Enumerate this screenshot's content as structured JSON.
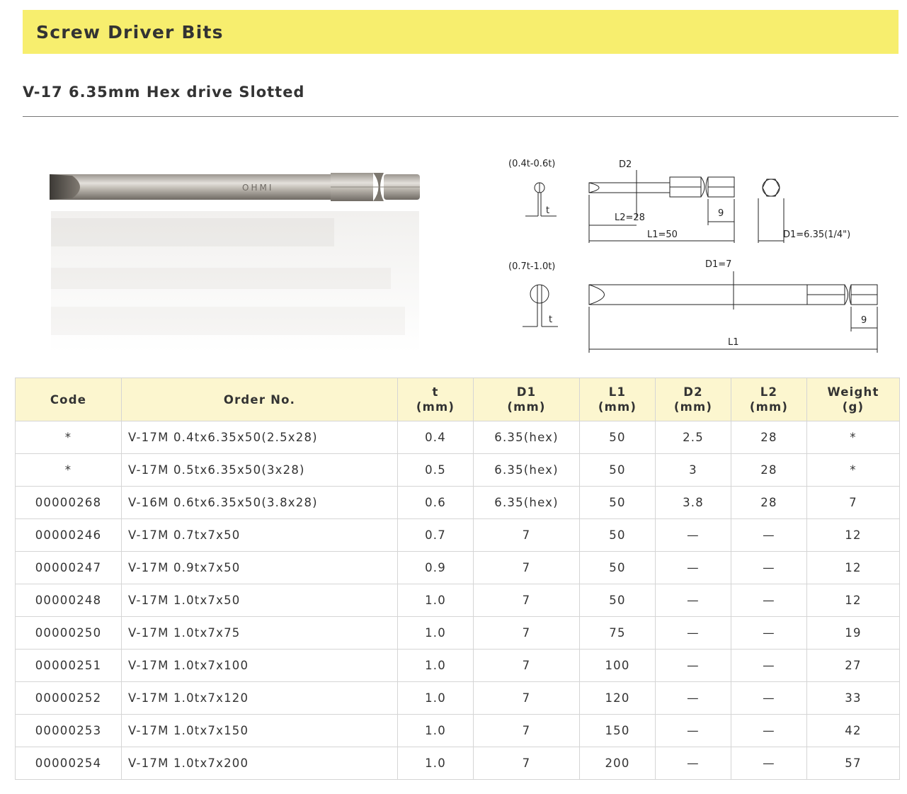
{
  "page": {
    "title": "Screw Driver Bits",
    "subtitle": "V-17 6.35mm Hex drive Slotted"
  },
  "drawing": {
    "label_thin_range": "(0.4t-0.6t)",
    "label_thick_range": "(0.7t-1.0t)",
    "t": "t",
    "d2": "D2",
    "l2": "L2=28",
    "nine": "9",
    "l1_50": "L1=50",
    "d1_hex": "D1=6.35(1/4\")",
    "d1_7": "D1=7",
    "l1": "L1"
  },
  "photo": {
    "engraving": "OHMI"
  },
  "table": {
    "headers": [
      {
        "line1": "Code",
        "line2": ""
      },
      {
        "line1": "Order No.",
        "line2": ""
      },
      {
        "line1": "t",
        "line2": "(mm)"
      },
      {
        "line1": "D1",
        "line2": "(mm)"
      },
      {
        "line1": "L1",
        "line2": "(mm)"
      },
      {
        "line1": "D2",
        "line2": "(mm)"
      },
      {
        "line1": "L2",
        "line2": "(mm)"
      },
      {
        "line1": "Weight",
        "line2": "(g)"
      }
    ],
    "rows": [
      [
        "*",
        "V-17M 0.4tx6.35x50(2.5x28)",
        "0.4",
        "6.35(hex)",
        "50",
        "2.5",
        "28",
        "*"
      ],
      [
        "*",
        "V-17M 0.5tx6.35x50(3x28)",
        "0.5",
        "6.35(hex)",
        "50",
        "3",
        "28",
        "*"
      ],
      [
        "00000268",
        "V-16M 0.6tx6.35x50(3.8x28)",
        "0.6",
        "6.35(hex)",
        "50",
        "3.8",
        "28",
        "7"
      ],
      [
        "00000246",
        "V-17M 0.7tx7x50",
        "0.7",
        "7",
        "50",
        "—",
        "—",
        "12"
      ],
      [
        "00000247",
        "V-17M 0.9tx7x50",
        "0.9",
        "7",
        "50",
        "—",
        "—",
        "12"
      ],
      [
        "00000248",
        "V-17M 1.0tx7x50",
        "1.0",
        "7",
        "50",
        "—",
        "—",
        "12"
      ],
      [
        "00000250",
        "V-17M 1.0tx7x75",
        "1.0",
        "7",
        "75",
        "—",
        "—",
        "19"
      ],
      [
        "00000251",
        "V-17M 1.0tx7x100",
        "1.0",
        "7",
        "100",
        "—",
        "—",
        "27"
      ],
      [
        "00000252",
        "V-17M 1.0tx7x120",
        "1.0",
        "7",
        "120",
        "—",
        "—",
        "33"
      ],
      [
        "00000253",
        "V-17M 1.0tx7x150",
        "1.0",
        "7",
        "150",
        "—",
        "—",
        "42"
      ],
      [
        "00000254",
        "V-17M 1.0tx7x200",
        "1.0",
        "7",
        "200",
        "—",
        "—",
        "57"
      ]
    ]
  },
  "colors": {
    "banner": "#f7ee6e",
    "table_header": "#fcf6cf",
    "border": "#d5d5d5",
    "text": "#333333"
  }
}
